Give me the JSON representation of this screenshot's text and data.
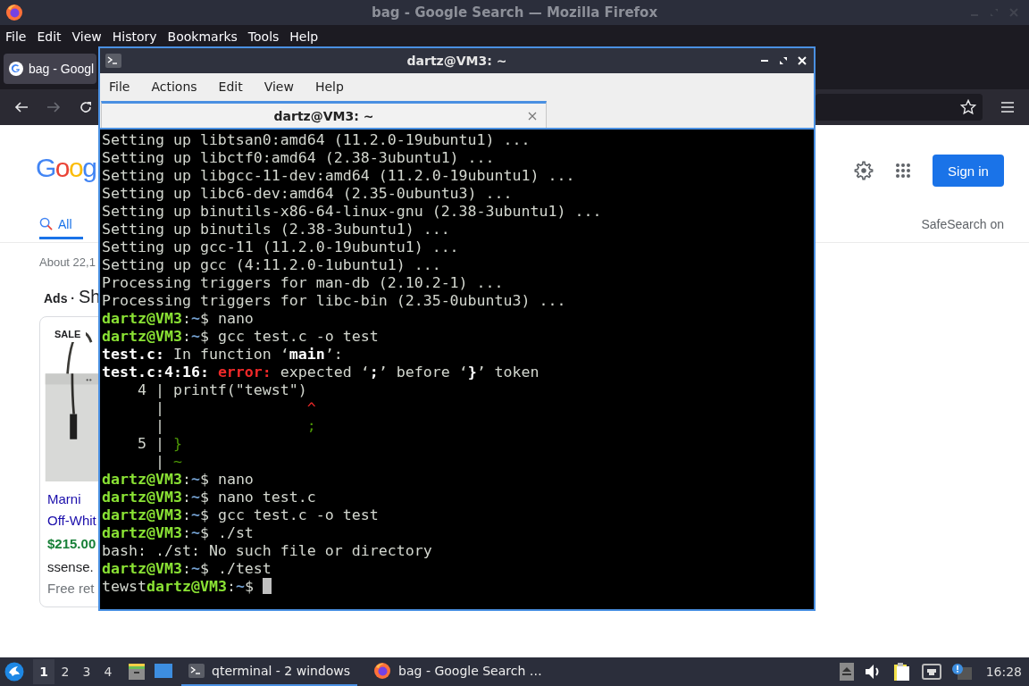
{
  "firefox": {
    "title": "bag - Google Search — Mozilla Firefox",
    "menu": [
      "File",
      "Edit",
      "View",
      "History",
      "Bookmarks",
      "Tools",
      "Help"
    ],
    "tabs": [
      {
        "label": "bag - Googl",
        "selected": true
      }
    ],
    "page": {
      "logo": "Goog",
      "search_tabs": [
        {
          "label": "All",
          "selected": true
        }
      ],
      "result_stats": "About 22,1",
      "ads_label": "Ads ·",
      "ads_title": "Sh",
      "product": {
        "badge": "SALE",
        "title_lines": [
          "Marni",
          "Off-Whit"
        ],
        "price": "$215.00",
        "store": "ssense.",
        "shipping": "Free ret"
      },
      "sign_in": "Sign in",
      "safesearch": "SafeSearch on"
    }
  },
  "terminal": {
    "title": "dartz@VM3: ~",
    "menu": [
      "File",
      "Actions",
      "Edit",
      "View",
      "Help"
    ],
    "tabs": [
      {
        "label": "dartz@VM3: ~",
        "selected": true
      }
    ],
    "cursor": true,
    "lines": [
      [
        {
          "text": "Setting up libtsan0:amd64 (11.2.0-19ubuntu1) ...",
          "kind": "plain"
        }
      ],
      [
        {
          "text": "Setting up libctf0:amd64 (2.38-3ubuntu1) ...",
          "kind": "plain"
        }
      ],
      [
        {
          "text": "Setting up libgcc-11-dev:amd64 (11.2.0-19ubuntu1) ...",
          "kind": "plain"
        }
      ],
      [
        {
          "text": "Setting up libc6-dev:amd64 (2.35-0ubuntu3) ...",
          "kind": "plain"
        }
      ],
      [
        {
          "text": "Setting up binutils-x86-64-linux-gnu (2.38-3ubuntu1) ...",
          "kind": "plain"
        }
      ],
      [
        {
          "text": "Setting up binutils (2.38-3ubuntu1) ...",
          "kind": "plain"
        }
      ],
      [
        {
          "text": "Setting up gcc-11 (11.2.0-19ubuntu1) ...",
          "kind": "plain"
        }
      ],
      [
        {
          "text": "Setting up gcc (4:11.2.0-1ubuntu1) ...",
          "kind": "plain"
        }
      ],
      [
        {
          "text": "Processing triggers for man-db (2.10.2-1) ...",
          "kind": "plain"
        }
      ],
      [
        {
          "text": "Processing triggers for libc-bin (2.35-0ubuntu3) ...",
          "kind": "plain"
        }
      ],
      [
        {
          "text": "dartz@VM3",
          "kind": "user"
        },
        {
          "text": ":",
          "kind": "plain"
        },
        {
          "text": "~",
          "kind": "path"
        },
        {
          "text": "$ nano",
          "kind": "plain"
        }
      ],
      [
        {
          "text": "dartz@VM3",
          "kind": "user"
        },
        {
          "text": ":",
          "kind": "plain"
        },
        {
          "text": "~",
          "kind": "path"
        },
        {
          "text": "$ gcc test.c -o test",
          "kind": "plain"
        }
      ],
      [
        {
          "text": "test.c:",
          "kind": "bold"
        },
        {
          "text": " In function ‘",
          "kind": "plain"
        },
        {
          "text": "main",
          "kind": "bold"
        },
        {
          "text": "’:",
          "kind": "plain"
        }
      ],
      [
        {
          "text": "test.c:4:16: ",
          "kind": "bold"
        },
        {
          "text": "error:",
          "kind": "error"
        },
        {
          "text": " expected ‘",
          "kind": "plain"
        },
        {
          "text": ";",
          "kind": "bold"
        },
        {
          "text": "’ before ‘",
          "kind": "plain"
        },
        {
          "text": "}",
          "kind": "bold"
        },
        {
          "text": "’ token",
          "kind": "plain"
        }
      ],
      [
        {
          "text": "    4 | printf(\"tewst\")",
          "kind": "plain"
        }
      ],
      [
        {
          "text": "      |                ",
          "kind": "plain"
        },
        {
          "text": "^",
          "kind": "caret"
        }
      ],
      [
        {
          "text": "      |                ",
          "kind": "plain"
        },
        {
          "text": ";",
          "kind": "fixit"
        }
      ],
      [
        {
          "text": "    5 | ",
          "kind": "plain"
        },
        {
          "text": "}",
          "kind": "fixit"
        }
      ],
      [
        {
          "text": "      | ",
          "kind": "plain"
        },
        {
          "text": "~",
          "kind": "fixit"
        }
      ],
      [
        {
          "text": "dartz@VM3",
          "kind": "user"
        },
        {
          "text": ":",
          "kind": "plain"
        },
        {
          "text": "~",
          "kind": "path"
        },
        {
          "text": "$ nano",
          "kind": "plain"
        }
      ],
      [
        {
          "text": "dartz@VM3",
          "kind": "user"
        },
        {
          "text": ":",
          "kind": "plain"
        },
        {
          "text": "~",
          "kind": "path"
        },
        {
          "text": "$ nano test.c",
          "kind": "plain"
        }
      ],
      [
        {
          "text": "dartz@VM3",
          "kind": "user"
        },
        {
          "text": ":",
          "kind": "plain"
        },
        {
          "text": "~",
          "kind": "path"
        },
        {
          "text": "$ gcc test.c -o test",
          "kind": "plain"
        }
      ],
      [
        {
          "text": "dartz@VM3",
          "kind": "user"
        },
        {
          "text": ":",
          "kind": "plain"
        },
        {
          "text": "~",
          "kind": "path"
        },
        {
          "text": "$ ./st",
          "kind": "plain"
        }
      ],
      [
        {
          "text": "bash: ./st: No such file or directory",
          "kind": "plain"
        }
      ],
      [
        {
          "text": "dartz@VM3",
          "kind": "user"
        },
        {
          "text": ":",
          "kind": "plain"
        },
        {
          "text": "~",
          "kind": "path"
        },
        {
          "text": "$ ./test",
          "kind": "plain"
        }
      ],
      [
        {
          "text": "tewst",
          "kind": "plain"
        },
        {
          "text": "dartz@VM3",
          "kind": "user"
        },
        {
          "text": ":",
          "kind": "plain"
        },
        {
          "text": "~",
          "kind": "path"
        },
        {
          "text": "$ ",
          "kind": "plain"
        }
      ]
    ]
  },
  "taskbar": {
    "workspaces": [
      {
        "label": "1",
        "selected": true
      },
      {
        "label": "2",
        "selected": false
      },
      {
        "label": "3",
        "selected": false
      },
      {
        "label": "4",
        "selected": false
      }
    ],
    "tasks": [
      {
        "label": "qterminal - 2 windows",
        "kind": "terminal",
        "selected": true
      },
      {
        "label": "bag - Google Search …",
        "kind": "browser",
        "selected": false
      }
    ],
    "clock": "16:28"
  }
}
